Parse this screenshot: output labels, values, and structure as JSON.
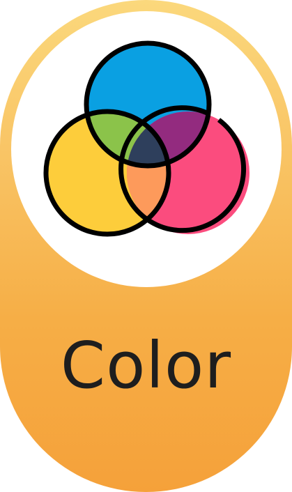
{
  "label": "Color",
  "icon": "color-venn-icon",
  "colors": {
    "gradient_top": "#fbd87c",
    "gradient_bottom": "#f5a13a",
    "blue": "#0aa0e2",
    "yellow": "#fdcd3b",
    "pink": "#fb4c7e",
    "green": "#8bc34a",
    "purple": "#932b7f",
    "orange": "#fd9a5b",
    "center": "#2e3f5c",
    "label_text": "#1e1e1e"
  }
}
